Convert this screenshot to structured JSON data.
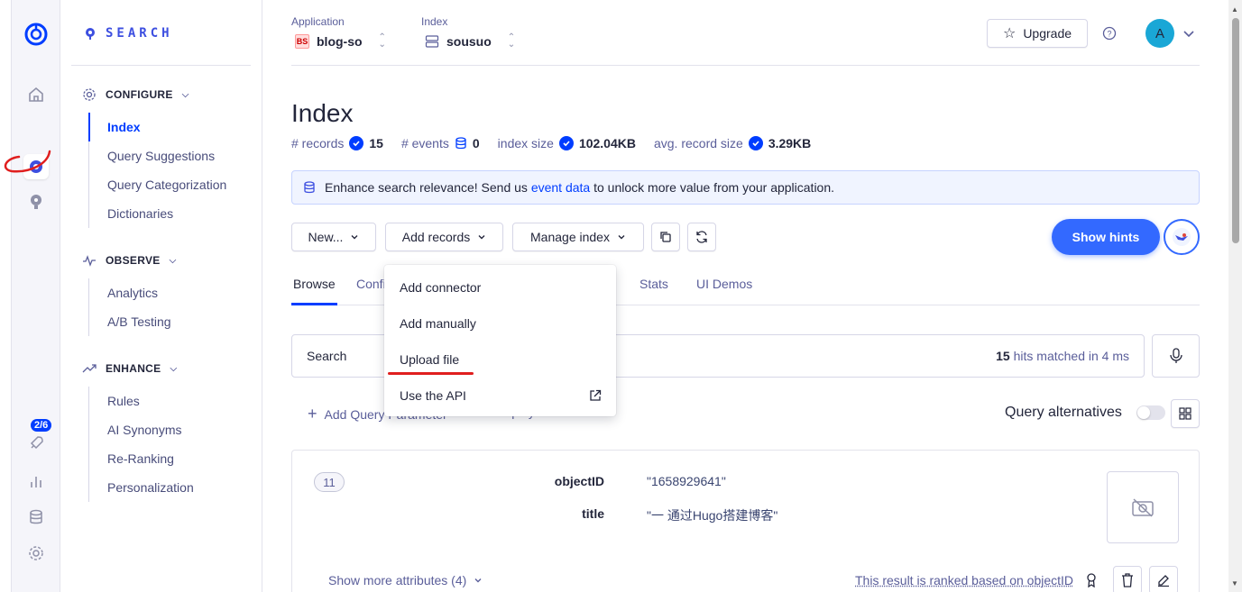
{
  "nav": {
    "logo_text": "SEARCH",
    "sections": [
      {
        "title": "CONFIGURE",
        "items": [
          "Index",
          "Query Suggestions",
          "Query Categorization",
          "Dictionaries"
        ]
      },
      {
        "title": "OBSERVE",
        "items": [
          "Analytics",
          "A/B Testing"
        ]
      },
      {
        "title": "ENHANCE",
        "items": [
          "Rules",
          "AI Synonyms",
          "Re-Ranking",
          "Personalization"
        ]
      }
    ],
    "active_item": "Index"
  },
  "rail": {
    "badge": "2/6"
  },
  "topbar": {
    "application_label": "Application",
    "application_badge": "BS",
    "application_value": "blog-so",
    "index_label": "Index",
    "index_value": "sousuo",
    "upgrade_label": "Upgrade",
    "avatar_initial": "A"
  },
  "page": {
    "title": "Index",
    "stats": {
      "records_label": "# records",
      "records_value": "15",
      "events_label": "# events",
      "events_value": "0",
      "index_size_label": "index size",
      "index_size_value": "102.04KB",
      "avg_record_label": "avg. record size",
      "avg_record_value": "3.29KB"
    },
    "banner": {
      "text_before": "Enhance search relevance! Send us",
      "link": "event data",
      "text_after": "to unlock more value from your application."
    }
  },
  "toolbar": {
    "new_label": "New...",
    "add_records_label": "Add records",
    "manage_index_label": "Manage index",
    "show_hints_label": "Show hints"
  },
  "tabs": [
    "Browse",
    "Confi",
    "Stats",
    "UI Demos"
  ],
  "dropdown": {
    "items": [
      "Add connector",
      "Add manually",
      "Upload file",
      "Use the API"
    ]
  },
  "search": {
    "placeholder": "Search",
    "hits_count": "15",
    "hits_text": "hits matched in 4 ms"
  },
  "query_line": {
    "add_param": "Add Query Parameter",
    "display_prefs": "Display Preferences",
    "alternatives": "Query alternatives"
  },
  "result": {
    "rank": "11",
    "attributes": [
      {
        "key": "objectID",
        "value": "\"1658929641\""
      },
      {
        "key": "title",
        "value": "\"一 通过Hugo搭建博客\""
      }
    ],
    "show_more": "Show more attributes (4)",
    "ranked_text": "This result is ranked based on objectID"
  },
  "colors": {
    "accent": "#003dff",
    "hints": "#3369ff",
    "annotation_red": "#e01e1e"
  }
}
